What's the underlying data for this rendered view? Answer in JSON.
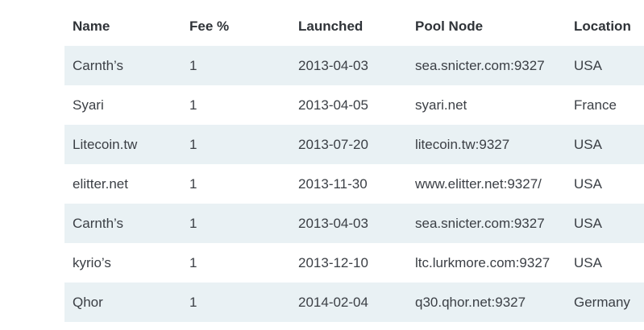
{
  "table": {
    "headers": [
      "Name",
      "Fee %",
      "Launched",
      "Pool Node",
      "Location"
    ],
    "rows": [
      {
        "name": "Carnth’s",
        "fee": "1",
        "launched": "2013-04-03",
        "node": "sea.snicter.com:9327",
        "location": "USA"
      },
      {
        "name": "Syari",
        "fee": "1",
        "launched": "2013-04-05",
        "node": "syari.net",
        "location": "France"
      },
      {
        "name": "Litecoin.tw",
        "fee": "1",
        "launched": "2013-07-20",
        "node": "litecoin.tw:9327",
        "location": "USA"
      },
      {
        "name": "elitter.net",
        "fee": "1",
        "launched": "2013-11-30",
        "node": "www.elitter.net:9327/",
        "location": "USA"
      },
      {
        "name": "Carnth’s",
        "fee": "1",
        "launched": "2013-04-03",
        "node": "sea.snicter.com:9327",
        "location": "USA"
      },
      {
        "name": "kyrio’s",
        "fee": "1",
        "launched": "2013-12-10",
        "node": "ltc.lurkmore.com:9327",
        "location": "USA"
      },
      {
        "name": "Qhor",
        "fee": "1",
        "launched": "2014-02-04",
        "node": "q30.qhor.net:9327",
        "location": "Germany"
      }
    ]
  },
  "colors": {
    "stripe": "#e9f1f4",
    "header_text": "#2f3338",
    "body_text": "#3b3f45"
  }
}
